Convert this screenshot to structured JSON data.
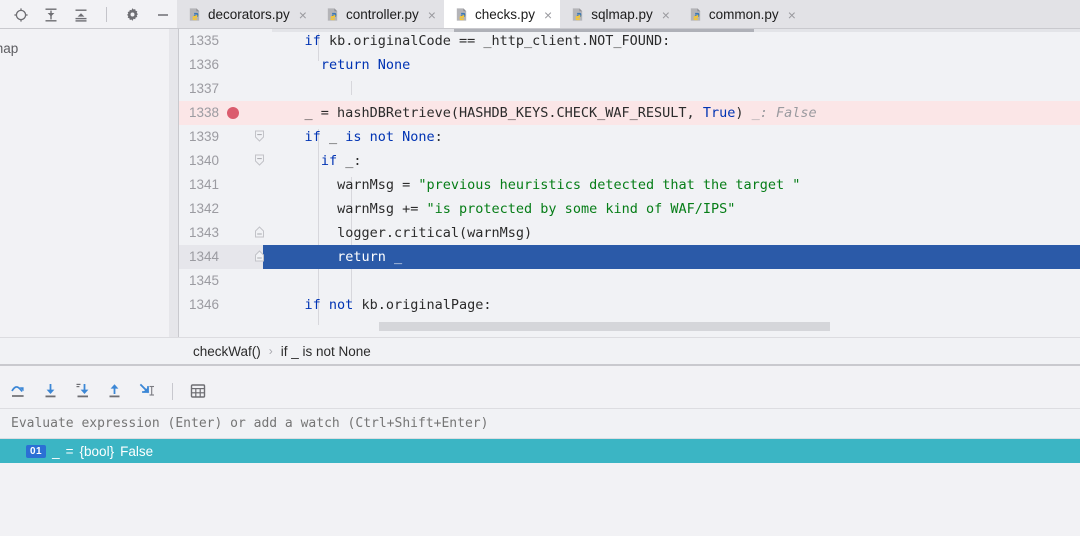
{
  "toolbar": {
    "icons": [
      {
        "name": "locate-target-icon",
        "title": "Show Execution Point"
      },
      {
        "name": "expand-all-icon",
        "title": "Expand All"
      },
      {
        "name": "collapse-all-icon",
        "title": "Collapse All"
      },
      {
        "name": "settings-gear-icon",
        "title": "Settings"
      },
      {
        "name": "minimize-icon",
        "title": "Hide"
      }
    ]
  },
  "tabs": [
    {
      "label": "decorators.py",
      "active": false
    },
    {
      "label": "controller.py",
      "active": false
    },
    {
      "label": "checks.py",
      "active": true
    },
    {
      "label": "sqlmap.py",
      "active": false
    },
    {
      "label": "common.py",
      "active": false
    }
  ],
  "tab_close_glyph": "×",
  "left_panel": {
    "clipped_label": "map"
  },
  "editor": {
    "lines": [
      {
        "num": "1335",
        "indent": 2,
        "breakpoint": false,
        "fold": "none",
        "selected": false,
        "tokens": [
          {
            "t": "if ",
            "c": "kw"
          },
          {
            "t": "kb.originalCode == _http_client.NOT_FOUND:",
            "c": "plain"
          }
        ]
      },
      {
        "num": "1336",
        "indent": 3,
        "breakpoint": false,
        "fold": "none",
        "selected": false,
        "tokens": [
          {
            "t": "return ",
            "c": "kw"
          },
          {
            "t": "None",
            "c": "kw"
          }
        ]
      },
      {
        "num": "1337",
        "indent": 0,
        "breakpoint": false,
        "fold": "none",
        "selected": false,
        "tokens": []
      },
      {
        "num": "1338",
        "indent": 2,
        "breakpoint": true,
        "fold": "none",
        "selected": false,
        "tokens": [
          {
            "t": "_ = hashDBRetrieve(HASHDB_KEYS.CHECK_WAF_RESULT, ",
            "c": "plain"
          },
          {
            "t": "True",
            "c": "kw"
          },
          {
            "t": ")",
            "c": "plain"
          },
          {
            "t": "   _: False",
            "c": "hint"
          }
        ]
      },
      {
        "num": "1339",
        "indent": 2,
        "breakpoint": false,
        "fold": "open",
        "selected": false,
        "tokens": [
          {
            "t": "if ",
            "c": "kw"
          },
          {
            "t": "_ ",
            "c": "plain"
          },
          {
            "t": "is not ",
            "c": "kw"
          },
          {
            "t": "None",
            "c": "kw"
          },
          {
            "t": ":",
            "c": "plain"
          }
        ]
      },
      {
        "num": "1340",
        "indent": 3,
        "breakpoint": false,
        "fold": "open",
        "selected": false,
        "tokens": [
          {
            "t": "if ",
            "c": "kw"
          },
          {
            "t": "_:",
            "c": "plain"
          }
        ]
      },
      {
        "num": "1341",
        "indent": 4,
        "breakpoint": false,
        "fold": "none",
        "selected": false,
        "tokens": [
          {
            "t": "warnMsg = ",
            "c": "plain"
          },
          {
            "t": "\"previous heuristics detected that the target \"",
            "c": "str"
          }
        ]
      },
      {
        "num": "1342",
        "indent": 4,
        "breakpoint": false,
        "fold": "none",
        "selected": false,
        "tokens": [
          {
            "t": "warnMsg += ",
            "c": "plain"
          },
          {
            "t": "\"is protected by some kind of WAF/IPS\"",
            "c": "str"
          }
        ]
      },
      {
        "num": "1343",
        "indent": 4,
        "breakpoint": false,
        "fold": "close",
        "selected": false,
        "tokens": [
          {
            "t": "logger.critical(warnMsg)",
            "c": "plain"
          }
        ]
      },
      {
        "num": "1344",
        "indent": 4,
        "breakpoint": false,
        "fold": "close",
        "selected": true,
        "tokens": [
          {
            "t": "return ",
            "c": "kw"
          },
          {
            "t": "_",
            "c": "plain"
          }
        ]
      },
      {
        "num": "1345",
        "indent": 0,
        "breakpoint": false,
        "fold": "none",
        "selected": false,
        "tokens": []
      },
      {
        "num": "1346",
        "indent": 2,
        "breakpoint": false,
        "fold": "none",
        "selected": false,
        "tokens": [
          {
            "t": "if not ",
            "c": "kw"
          },
          {
            "t": "kb.originalPage:",
            "c": "plain"
          }
        ]
      }
    ]
  },
  "breadcrumb": {
    "items": [
      "checkWaf()",
      "if _ is not None"
    ],
    "separator": "›"
  },
  "debugger": {
    "toolbar_icons": [
      {
        "name": "step-over-icon",
        "title": "Step Over"
      },
      {
        "name": "step-into-icon",
        "title": "Step Into"
      },
      {
        "name": "force-step-into-icon",
        "title": "Force Step Into"
      },
      {
        "name": "step-out-icon",
        "title": "Step Out"
      },
      {
        "name": "run-to-cursor-icon",
        "title": "Run to Cursor"
      },
      {
        "name": "evaluate-expression-icon",
        "title": "Evaluate Expression"
      }
    ],
    "evaluate_placeholder": "Evaluate expression (Enter) or add a watch (Ctrl+Shift+Enter)",
    "evaluate_value": "",
    "watches": [
      {
        "index": "01",
        "expression": "_",
        "assign": "=",
        "type": "{bool}",
        "value": "False",
        "selected": true
      }
    ]
  },
  "colors": {
    "breakpoint": "#DB5C6E",
    "selection": "#2B5AA8",
    "watch_highlight": "#3BB5C4",
    "badge": "#2B6FD4",
    "keyword": "#0033B3",
    "string": "#067D17",
    "breakpoint_line_bg": "#FBE6E7"
  }
}
